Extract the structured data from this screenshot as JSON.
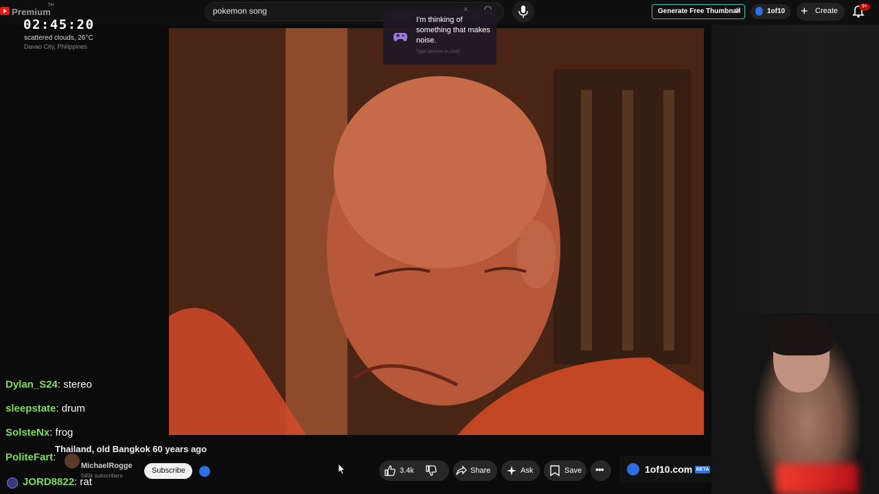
{
  "topbar": {
    "brand": "Premium",
    "region": "TH",
    "search_value": "pokemon song",
    "generate_thumbnail": "Generate Free Thumbnail",
    "oneof10_label": "1of10",
    "create_label": "Create",
    "notification_count": "9+"
  },
  "overlay_clock": {
    "time": "02:45:20",
    "weather": "scattered clouds, 26°C",
    "location": "Davao City, Philippines"
  },
  "popup": {
    "text": "I'm thinking of something that makes noise.",
    "hint": "Type answer in chat!"
  },
  "chat": [
    {
      "user": "Dylan_S24",
      "message": "stereo",
      "color": "#7ee05a"
    },
    {
      "user": "sleepstate",
      "message": "drum",
      "color": "#7ee05a"
    },
    {
      "user": "SolsteNx",
      "message": "frog",
      "color": "#7ee05a"
    },
    {
      "user": "PoliteFart",
      "message": "",
      "color": "#7ee05a"
    },
    {
      "user": "JORD8822",
      "message": "rat",
      "color": "#7ee05a"
    }
  ],
  "video": {
    "title": "Thailand, old Bangkok 60 years ago",
    "channel": "MichaelRogge",
    "subscribers": "545k subscribers",
    "subscribe_label": "Subscribe",
    "like_count": "3.4k",
    "share_label": "Share",
    "ask_label": "Ask",
    "save_label": "Save"
  },
  "extension": {
    "label": "1of10.com",
    "badge": "BETA"
  },
  "colors": {
    "accent_teal": "#2ec4c0",
    "oneof10_blue": "#2d6fe0",
    "chat_username": "#7ee05a"
  }
}
